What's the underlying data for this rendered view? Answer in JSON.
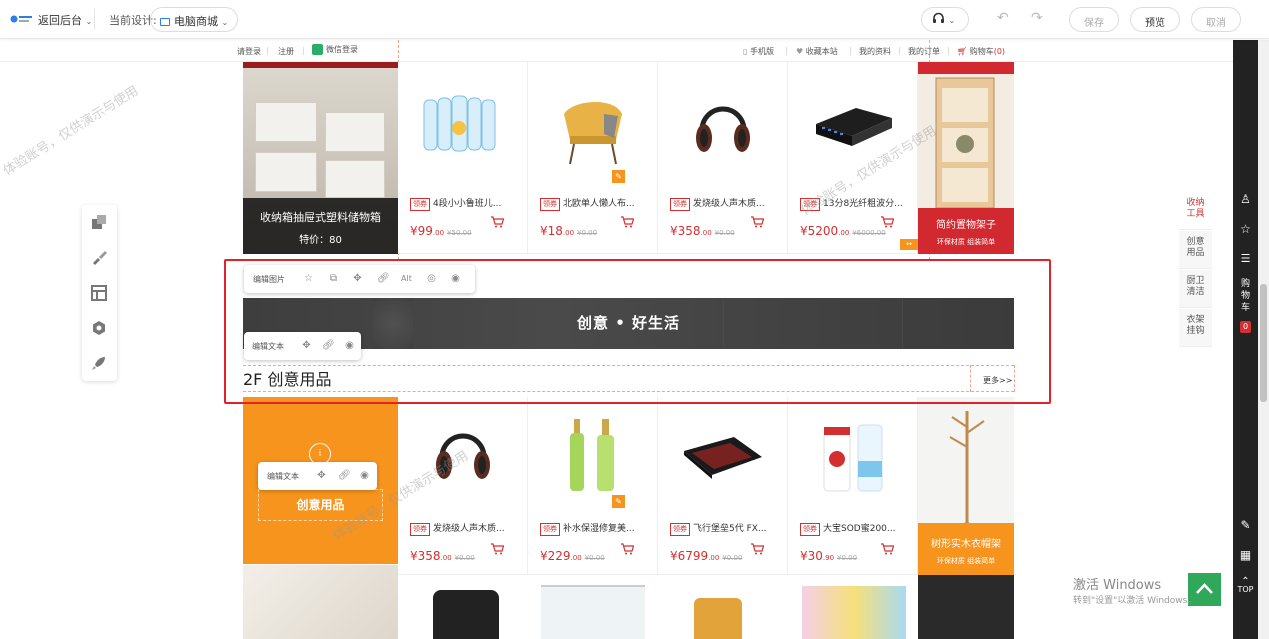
{
  "topbar": {
    "back_label": "返回后台",
    "current_design_label": "当前设计:",
    "device_label": "电脑商城",
    "save_label": "保存",
    "preview_label": "预览",
    "cancel_label": "取消"
  },
  "site_header": {
    "login": "请登录",
    "register": "注册",
    "wechat_login": "微信登录",
    "mobile": "手机版",
    "favorite": "收藏本站",
    "my_profile": "我的资料",
    "my_orders": "我的订单",
    "cart": "购物车",
    "cart_count": "(0)"
  },
  "floor1": {
    "promo_left": {
      "title": "收纳箱抽屉式塑料储物箱",
      "price": "特价：80"
    },
    "products": [
      {
        "coupon": "领券",
        "title": "4段小小鲁班儿...",
        "price_int": "¥99",
        "price_dec": ".00",
        "orig": "¥50.00"
      },
      {
        "coupon": "领券",
        "title": "北欧单人懒人布...",
        "price_int": "¥18",
        "price_dec": ".00",
        "orig": "¥0.00"
      },
      {
        "coupon": "领券",
        "title": "发烧级人声木质...",
        "price_int": "¥358",
        "price_dec": ".00",
        "orig": "¥0.00"
      },
      {
        "coupon": "领券",
        "title": "13分8光纤粗波分...",
        "price_int": "¥5200",
        "price_dec": ".00",
        "orig": "¥6000.00"
      }
    ],
    "promo_right": {
      "title": "简约置物架子",
      "sub": "环保材质 组装简单"
    }
  },
  "edit_toolbar_image": {
    "label": "编辑图片",
    "alt": "Alt"
  },
  "banner": {
    "text": "创意 • 好生活"
  },
  "edit_toolbar_text": {
    "label": "编辑文本"
  },
  "floor2": {
    "title": "2F 创意用品",
    "more": "更多>>",
    "promo_left": {
      "title": "创意用品",
      "edit_label": "编辑文本"
    },
    "products": [
      {
        "coupon": "领券",
        "title": "发烧级人声木质...",
        "price_int": "¥358",
        "price_dec": ".00",
        "orig": "¥0.00"
      },
      {
        "coupon": "领券",
        "title": "补水保湿修复美...",
        "price_int": "¥229",
        "price_dec": ".00",
        "orig": "¥0.00"
      },
      {
        "coupon": "领券",
        "title": "飞行堡垒5代 FX...",
        "price_int": "¥6799",
        "price_dec": ".00",
        "orig": "¥0.00"
      },
      {
        "coupon": "领券",
        "title": "大宝SOD蜜200...",
        "price_int": "¥30",
        "price_dec": ".90",
        "orig": "¥0.00"
      }
    ],
    "promo_right": {
      "title": "树形实木衣帽架",
      "sub": "环保材质 组装简单"
    }
  },
  "category_strip": [
    {
      "label1": "收纳",
      "label2": "工具"
    },
    {
      "label1": "创意",
      "label2": "用品"
    },
    {
      "label1": "厨卫",
      "label2": "清洁"
    },
    {
      "label1": "衣架",
      "label2": "挂钩"
    }
  ],
  "dark_toolbar": {
    "cart_label": "购物车",
    "cart_count": "0",
    "top_label": "TOP"
  },
  "watermark": "体验账号，仅供演示与使用",
  "windows": {
    "activate": "激活 Windows",
    "activate_hint": "转到\"设置\"以激活 Windows。"
  },
  "colors": {
    "accent": "#d32f2f",
    "orange": "#f7941d",
    "selection": "#e0232b",
    "green": "#2fa85a"
  }
}
